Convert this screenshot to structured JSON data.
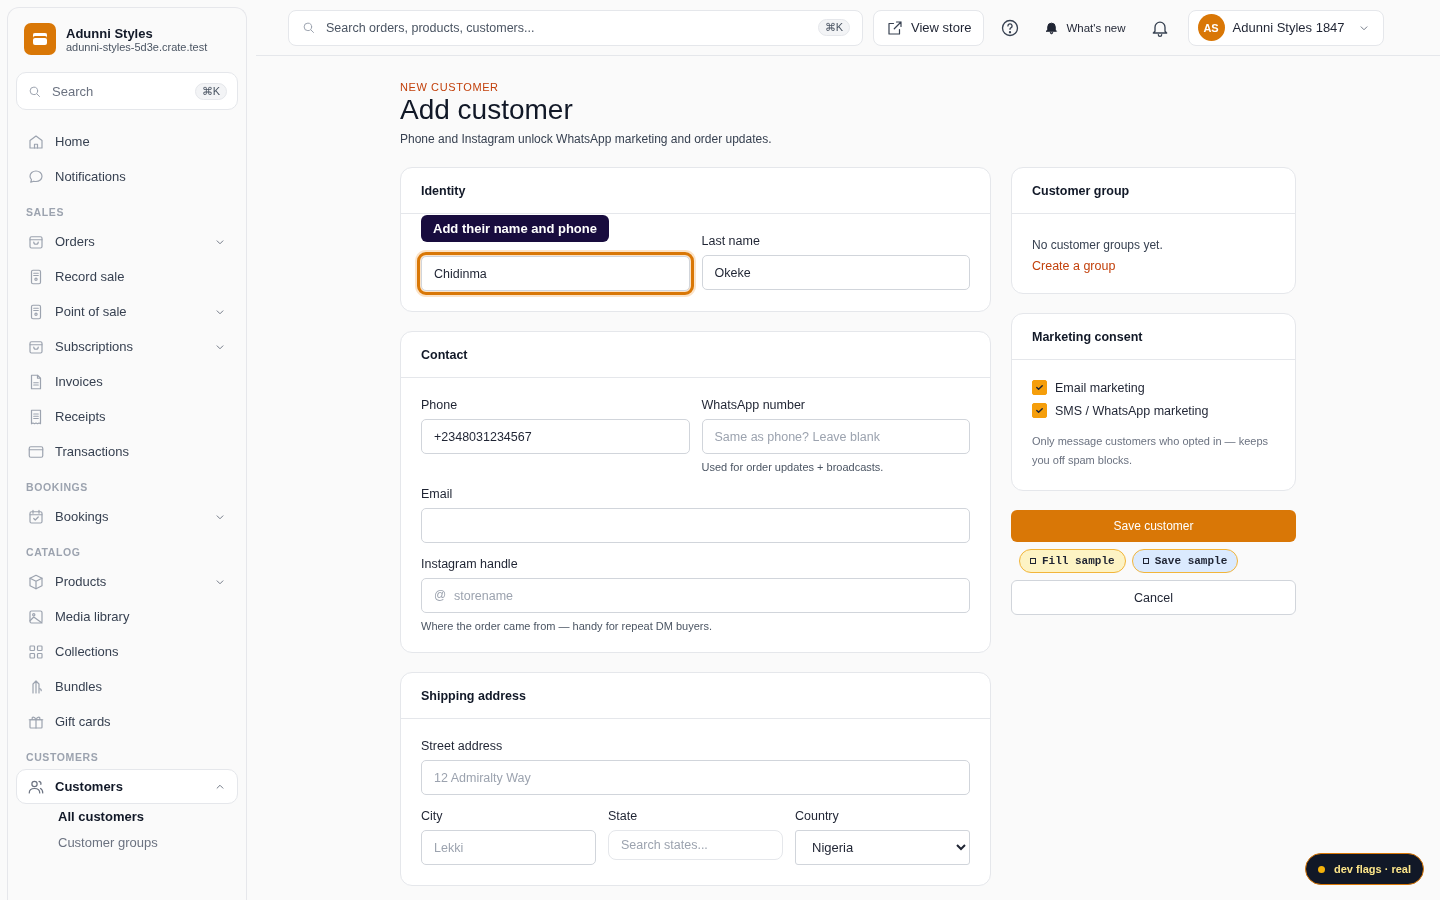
{
  "store": {
    "name": "Adunni Styles",
    "domain": "adunni-styles-5d3e.crate.test"
  },
  "sidebar_search": {
    "placeholder": "Search",
    "shortcut": "⌘K"
  },
  "nav": [
    {
      "items": [
        {
          "label": "Home",
          "selected": false
        },
        {
          "label": "Notifications",
          "selected": false
        }
      ]
    },
    {
      "heading": "SALES",
      "items": [
        {
          "label": "Orders",
          "selected": false,
          "expanded": false
        },
        {
          "label": "Record sale",
          "selected": false
        },
        {
          "label": "Point of sale",
          "selected": false,
          "expanded": false
        },
        {
          "label": "Subscriptions",
          "selected": false,
          "expanded": false
        },
        {
          "label": "Invoices",
          "selected": false
        },
        {
          "label": "Receipts",
          "selected": false
        },
        {
          "label": "Transactions",
          "selected": false
        }
      ]
    },
    {
      "heading": "BOOKINGS",
      "items": [
        {
          "label": "Bookings",
          "selected": false,
          "expanded": false
        }
      ]
    },
    {
      "heading": "CATALOG",
      "items": [
        {
          "label": "Products",
          "selected": false,
          "expanded": false
        },
        {
          "label": "Media library",
          "selected": false
        },
        {
          "label": "Collections",
          "selected": false
        },
        {
          "label": "Bundles",
          "selected": false
        },
        {
          "label": "Gift cards",
          "selected": false
        }
      ]
    },
    {
      "heading": "CUSTOMERS",
      "items": [
        {
          "label": "Customers",
          "selected": true,
          "expanded": true,
          "children": [
            {
              "label": "All customers",
              "selected": true
            },
            {
              "label": "Customer groups",
              "selected": false
            }
          ]
        }
      ]
    }
  ],
  "topbar": {
    "search": {
      "placeholder": "Search orders, products, customers...",
      "shortcut": "⌘K"
    },
    "view_store": "View store",
    "whats_new": "What's new",
    "account": {
      "initials": "AS",
      "name": "Adunni Styles 1847"
    }
  },
  "page": {
    "eyebrow": "NEW CUSTOMER",
    "title": "Add customer",
    "subtitle": "Phone and Instagram unlock WhatsApp marketing and order updates."
  },
  "identity": {
    "title": "Identity",
    "tooltip": "Add their name and phone",
    "first_name": {
      "value": "Chidinma",
      "focused": true
    },
    "last_name": {
      "label": "Last name",
      "value": "Okeke",
      "focused": false
    }
  },
  "contact": {
    "title": "Contact",
    "phone": {
      "label": "Phone",
      "value": "+2348031234567"
    },
    "whatsapp": {
      "label": "WhatsApp number",
      "placeholder": "Same as phone? Leave blank",
      "help": "Used for order updates + broadcasts."
    },
    "email": {
      "label": "Email"
    },
    "instagram": {
      "label": "Instagram handle",
      "prefix": "@",
      "placeholder": "storename",
      "help": "Where the order came from — handy for repeat DM buyers."
    }
  },
  "shipping": {
    "title": "Shipping address",
    "street": {
      "label": "Street address",
      "placeholder": "12 Admiralty Way"
    },
    "city": {
      "label": "City",
      "placeholder": "Lekki"
    },
    "state": {
      "label": "State",
      "placeholder": "Search states..."
    },
    "country": {
      "label": "Country",
      "value": "Nigeria"
    }
  },
  "customer_group": {
    "title": "Customer group",
    "empty": "No customer groups yet.",
    "link": "Create a group"
  },
  "consent": {
    "title": "Marketing consent",
    "options": [
      {
        "label": "Email marketing",
        "checked": true
      },
      {
        "label": "SMS / WhatsApp marketing",
        "checked": true
      }
    ],
    "note": "Only message customers who opted in — keeps you off spam blocks."
  },
  "actions": {
    "save": "Save customer",
    "dev_buttons": [
      {
        "label": "Fill sample",
        "color": "#fdf3c4"
      },
      {
        "label": "Save sample",
        "color": "#dbeafe"
      }
    ],
    "cancel": "Cancel"
  },
  "dev_badge": "dev flags · real"
}
